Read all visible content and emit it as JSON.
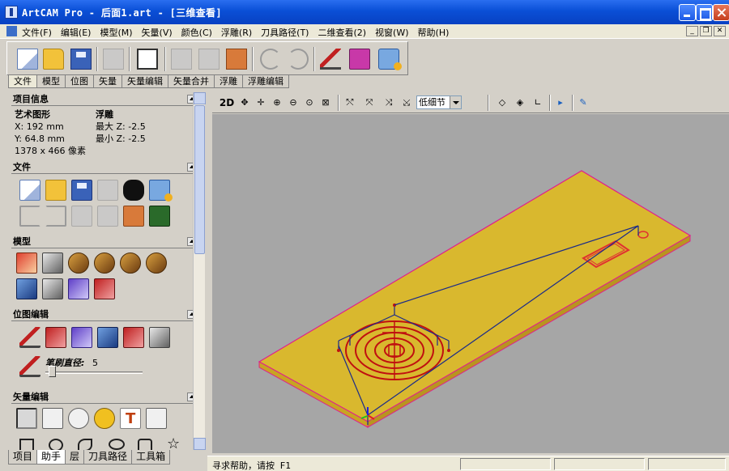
{
  "window": {
    "title": "ArtCAM Pro - 后面1.art - [三维查看]"
  },
  "menu": {
    "items": [
      "文件(F)",
      "编辑(E)",
      "模型(M)",
      "矢量(V)",
      "颜色(C)",
      "浮雕(R)",
      "刀具路径(T)",
      "二维查看(2)",
      "视窗(W)",
      "帮助(H)"
    ],
    "mdi": [
      "_",
      "❐",
      "✕"
    ]
  },
  "toolbar_tabs": [
    "文件",
    "模型",
    "位图",
    "矢量",
    "矢量编辑",
    "矢量合并",
    "浮雕",
    "浮雕编辑"
  ],
  "panel": {
    "project_info": {
      "header": "项目信息",
      "art_label": "艺术图形",
      "relief_label": "浮雕",
      "x": "X: 192 mm",
      "y": "Y: 64.8 mm",
      "pixels": "1378 x 466 像素",
      "max": "最大  Z: -2.5",
      "min": "最小  Z: -2.5"
    },
    "file_header": "文件",
    "model_header": "模型",
    "bitmap_header": "位图编辑",
    "brush_label": "笔刷直径:",
    "brush_value": "5",
    "vector_header": "矢量编辑"
  },
  "bottom_tabs": [
    "项目",
    "助手",
    "层",
    "刀具路径",
    "工具箱"
  ],
  "view_toolbar": {
    "label_2d": "2D",
    "detail": "低细节"
  },
  "status": {
    "message": "寻求帮助，请按 F1"
  },
  "colors": {
    "material": "#d9b82e",
    "edge": "#e0208c",
    "toolpath": "#c01010",
    "vector": "#1a2a8a",
    "background": "#a6a6a6"
  }
}
